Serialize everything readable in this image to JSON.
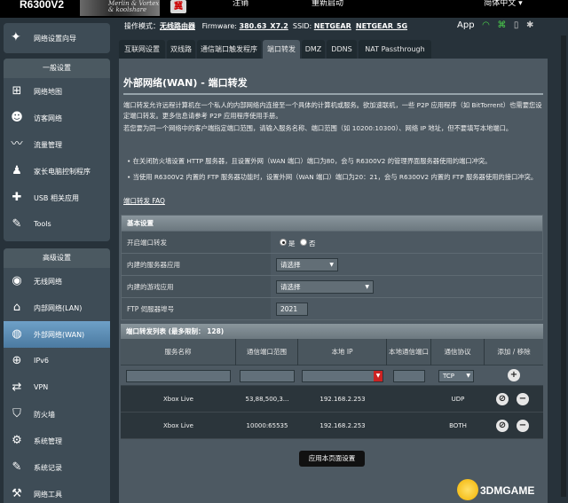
{
  "header": {
    "model": "R6300V2",
    "logo_text": "Merlin & Vortex\n& koolshare",
    "logo_seal": "冀",
    "logout": "注销",
    "reboot": "重新启动",
    "language": "简体中文"
  },
  "info": {
    "mode_label": "操作模式：",
    "mode_value": "无线路由器",
    "fw_label": "Firmware:",
    "fw_value": "380.63_X7.2",
    "ssid_label": "SSID:",
    "ssid_1": "NETGEAR",
    "ssid_2": "NETGEAR_5G",
    "app_label": "App"
  },
  "sidebar": {
    "wizard": "网络设置向导",
    "general_header": "一般设置",
    "general_items": [
      {
        "label": "网络地图"
      },
      {
        "label": "访客网络"
      },
      {
        "label": "流量管理"
      },
      {
        "label": "家长电脑控制程序"
      },
      {
        "label": "USB 相关应用"
      },
      {
        "label": "Tools"
      }
    ],
    "advanced_header": "高级设置",
    "advanced_items": [
      {
        "label": "无线网络"
      },
      {
        "label": "内部网络(LAN)"
      },
      {
        "label": "外部网络(WAN)"
      },
      {
        "label": "IPv6"
      },
      {
        "label": "VPN"
      },
      {
        "label": "防火墙"
      },
      {
        "label": "系统管理"
      },
      {
        "label": "系统记录"
      },
      {
        "label": "网络工具"
      }
    ]
  },
  "tabs": [
    "互联网设置",
    "双线路",
    "通信端口触发程序",
    "端口转发",
    "DMZ",
    "DDNS",
    "NAT Passthrough"
  ],
  "main": {
    "title": "外部网络(WAN) - 端口转发",
    "desc_1": "端口转发允许远程计算机在一个私人的内部网络内连接至一个具体的计算机或服务。欲加速联机，一些 P2P 应用程序（如 BitTorrent）也需要您设定端口转发。更多信息请参考 P2P 应用程序使用手册。",
    "desc_2": "若您要为同一个网络中的客户端指定端口范围，请输入服务名称、端口范围（如 10200:10300）、网络 IP 地址，但不要填写本地端口。",
    "bullet_1": "在关闭防火墙设置 HTTP 服务器，且设置外网（WAN 端口）端口为80，会与 R6300V2 的管理界面服务器使用的端口冲突。",
    "bullet_2": "当使用 R6300V2 内置的 FTP 服务器功能时，设置外网（WAN 端口）端口为20：21，会与 R6300V2 内置的 FTP 服务器使用的接口冲突。",
    "faq": "端口转发 FAQ"
  },
  "basic": {
    "header": "基本设置",
    "enable_label": "开启端口转发",
    "yes": "是",
    "no": "否",
    "server_label": "内建的服务器应用",
    "server_value": "请选择",
    "game_label": "内建的游戏应用",
    "game_value": "请选择",
    "ftp_label": "FTP 伺服器埠号",
    "ftp_value": "2021"
  },
  "plist": {
    "header": "端口转发列表 (最多限制： 128)",
    "columns": [
      "服务名称",
      "通信端口范围",
      "本地 IP",
      "本地通信端口",
      "通信协议",
      "添加 / 移除"
    ],
    "new_protocol": "TCP",
    "rows": [
      {
        "name": "Xbox Live",
        "ports": "53,88,500,3...",
        "ip": "192.168.2.253",
        "local_port": "",
        "protocol": "UDP"
      },
      {
        "name": "Xbox Live",
        "ports": "10000:65535",
        "ip": "192.168.2.253",
        "local_port": "",
        "protocol": "BOTH"
      }
    ]
  },
  "apply": "应用本页面设置",
  "watermark": "3DMGAME"
}
